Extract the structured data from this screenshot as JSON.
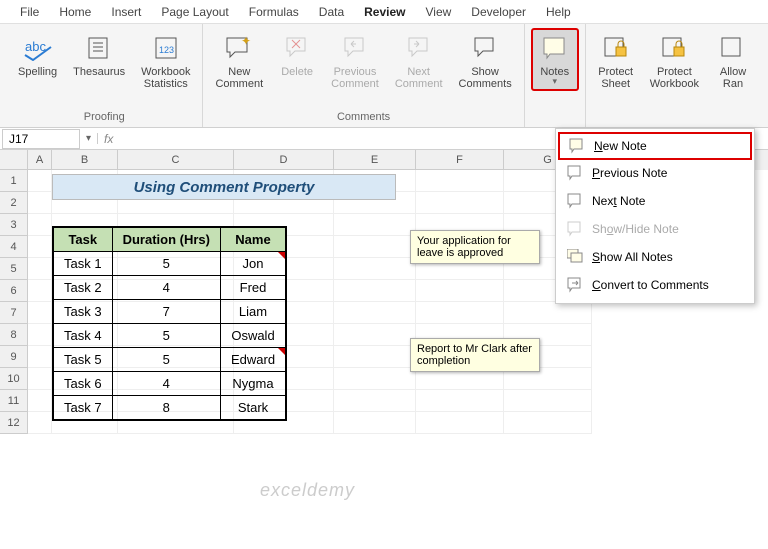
{
  "menubar": {
    "tabs": [
      "File",
      "Home",
      "Insert",
      "Page Layout",
      "Formulas",
      "Data",
      "Review",
      "View",
      "Developer",
      "Help"
    ],
    "active": "Review"
  },
  "ribbon": {
    "proofing": {
      "label": "Proofing",
      "spelling": "Spelling",
      "thesaurus": "Thesaurus",
      "workbook_stats": "Workbook\nStatistics"
    },
    "comments": {
      "label": "Comments",
      "new": "New\nComment",
      "delete": "Delete",
      "previous": "Previous\nComment",
      "next": "Next\nComment",
      "show": "Show\nComments"
    },
    "notes": {
      "label": "Notes"
    },
    "protect": {
      "sheet": "Protect\nSheet",
      "workbook": "Protect\nWorkbook",
      "allow": "Allow\nRan"
    }
  },
  "namebox": "J17",
  "sheet": {
    "title": "Using Comment Property",
    "headers": {
      "task": "Task",
      "duration": "Duration (Hrs)",
      "name": "Name"
    },
    "rows": [
      {
        "task": "Task 1",
        "duration": "5",
        "name": "Jon",
        "note": "Your application for leave is approved"
      },
      {
        "task": "Task 2",
        "duration": "4",
        "name": "Fred"
      },
      {
        "task": "Task 3",
        "duration": "7",
        "name": "Liam"
      },
      {
        "task": "Task 4",
        "duration": "5",
        "name": "Oswald"
      },
      {
        "task": "Task 5",
        "duration": "5",
        "name": "Edward",
        "note": "Report to Mr Clark after completion"
      },
      {
        "task": "Task 6",
        "duration": "4",
        "name": "Nygma"
      },
      {
        "task": "Task 7",
        "duration": "8",
        "name": "Stark"
      }
    ]
  },
  "dropdown": {
    "new_note": "New Note",
    "previous": "Previous Note",
    "next": "Next Note",
    "showhide": "Show/Hide Note",
    "show_all": "Show All Notes",
    "convert": "Convert to Comments"
  },
  "watermark": "exceldemy"
}
